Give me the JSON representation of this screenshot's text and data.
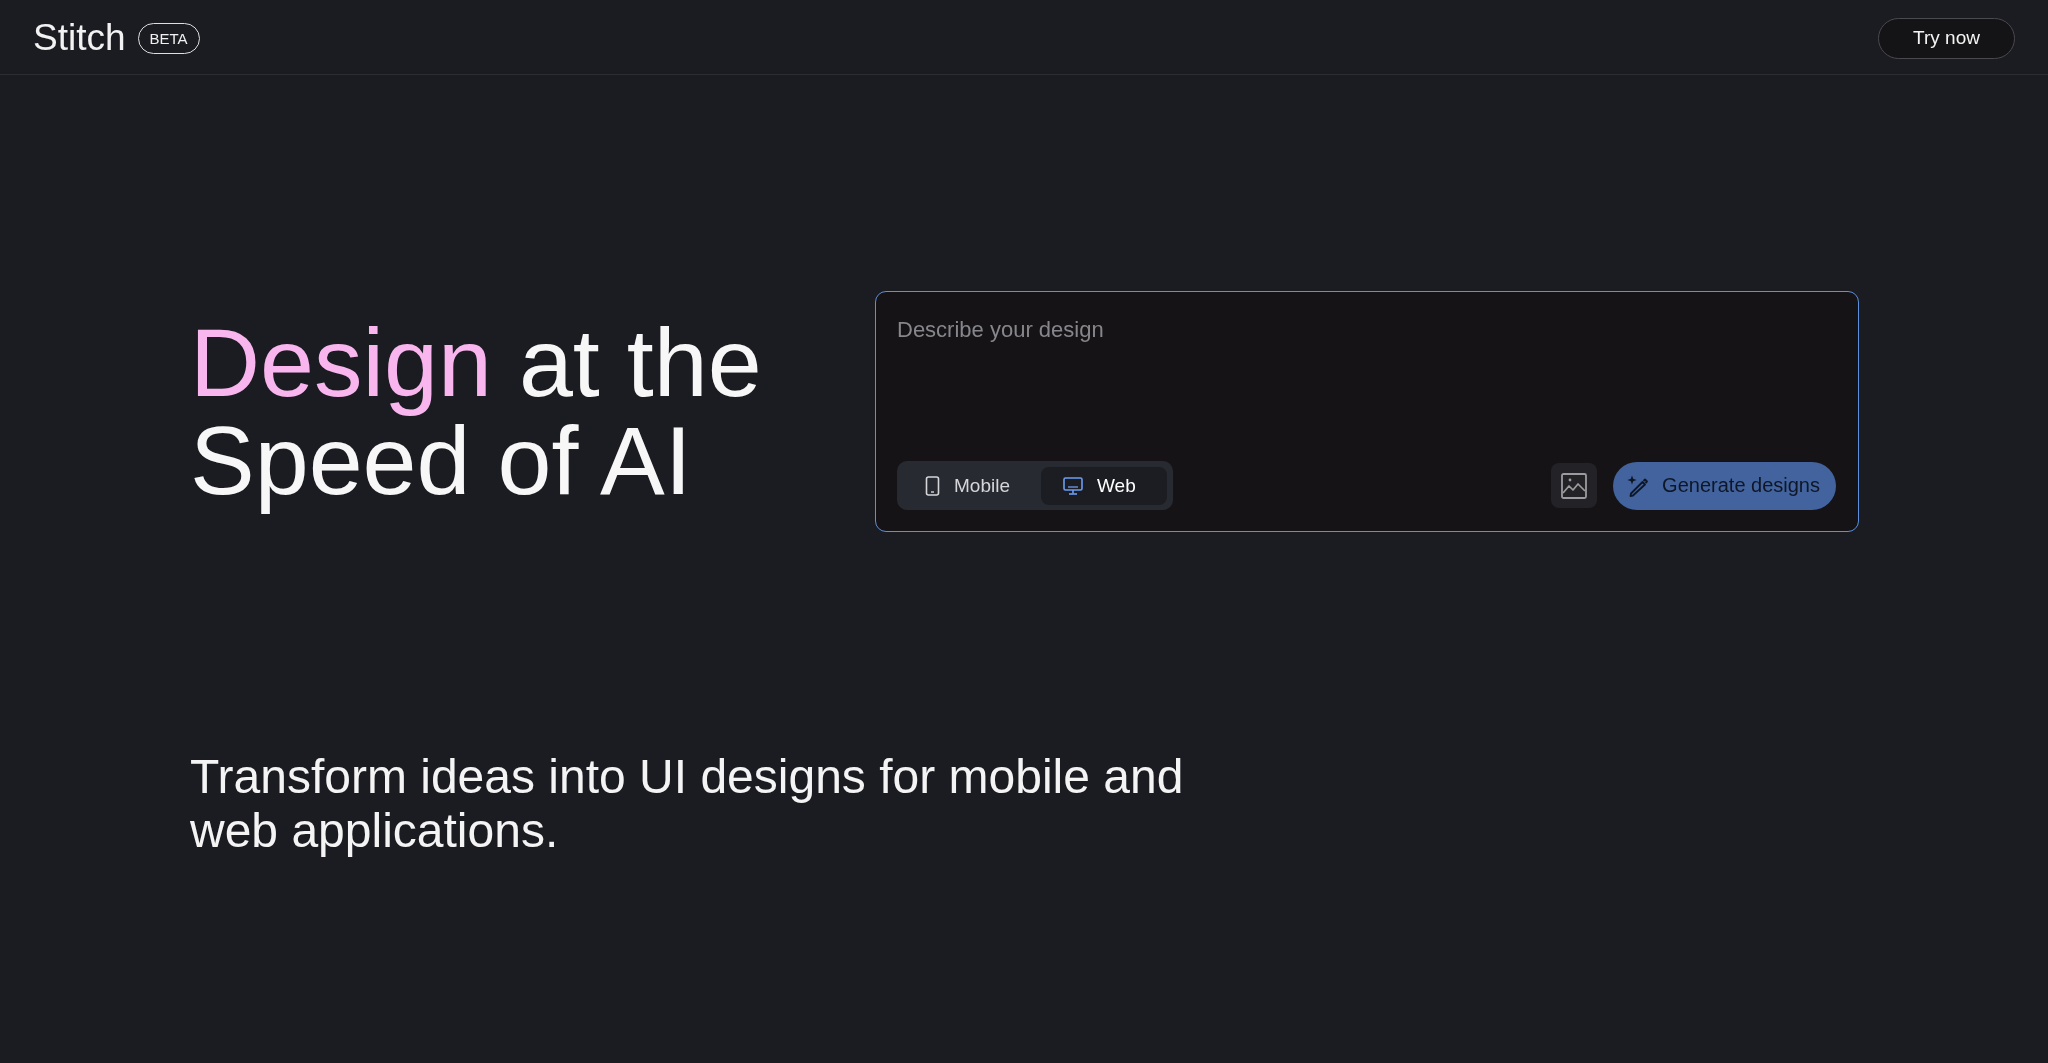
{
  "header": {
    "logo": "Stitch",
    "badge": "BETA",
    "cta": "Try now"
  },
  "hero": {
    "headline": {
      "highlight": "Design",
      "rest": "at the Speed of AI"
    }
  },
  "prompt": {
    "placeholder": "Describe your design",
    "platforms": [
      {
        "label": "Mobile",
        "kind": "mobile",
        "selected": false
      },
      {
        "label": "Web",
        "kind": "web",
        "selected": true
      }
    ],
    "submit": "Generate designs"
  },
  "tagline": "Transform ideas into UI designs for mobile and web applications."
}
